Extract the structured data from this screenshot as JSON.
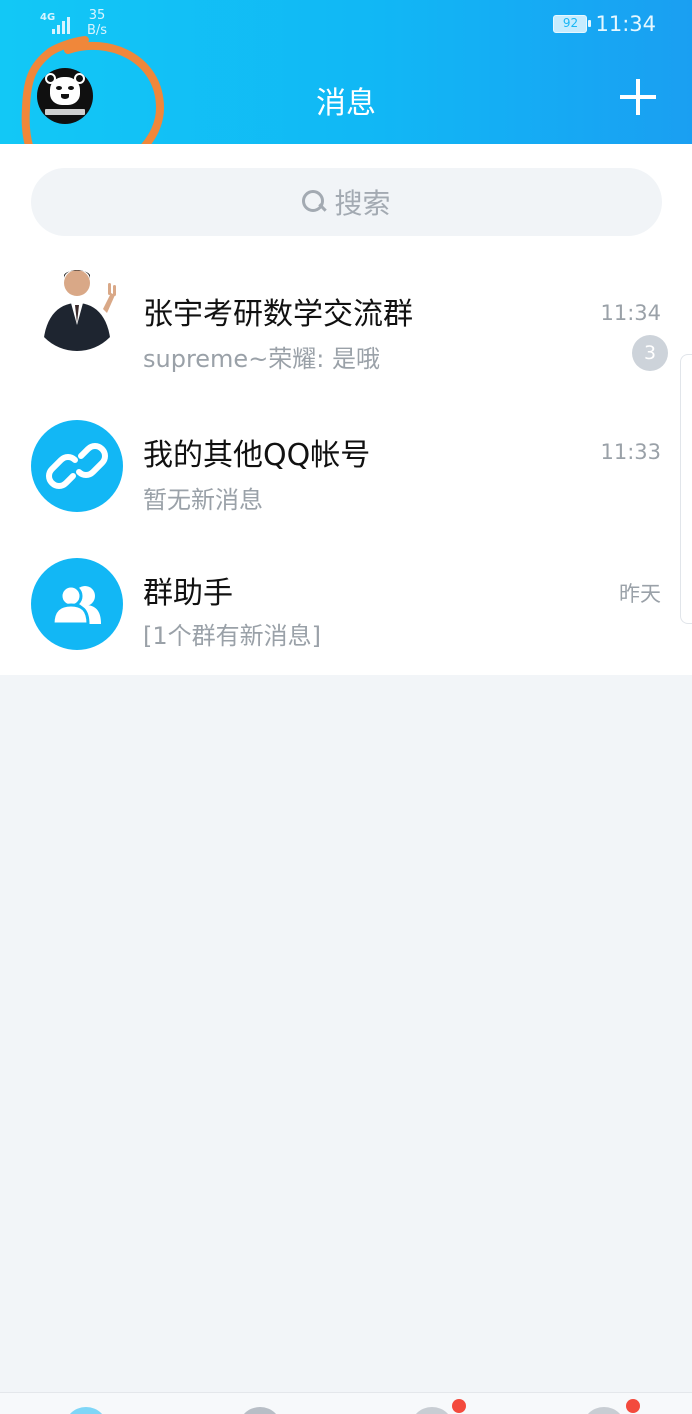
{
  "status_bar": {
    "network": "4G",
    "speed_value": "35",
    "speed_unit": "B/s",
    "battery": "92",
    "time": "11:34"
  },
  "header": {
    "title": "消息",
    "add_icon": "plus-icon",
    "avatar_icon": "panda-avatar"
  },
  "search": {
    "placeholder": "搜索"
  },
  "conversations": [
    {
      "name": "张宇考研数学交流群",
      "preview": "supreme~荣耀: 是哦",
      "time": "11:34",
      "unread": "3",
      "avatar": "person-photo"
    },
    {
      "name": "我的其他QQ帐号",
      "preview": "暂无新消息",
      "time": "11:33",
      "avatar": "link-icon"
    },
    {
      "name": "群助手",
      "preview": "[1个群有新消息]",
      "time": "昨天",
      "avatar": "group-icon"
    }
  ],
  "colors": {
    "header": "#12b7f5",
    "accent": "#12b7f5",
    "annotation": "#f0873a",
    "badge": "#cdd3da"
  }
}
